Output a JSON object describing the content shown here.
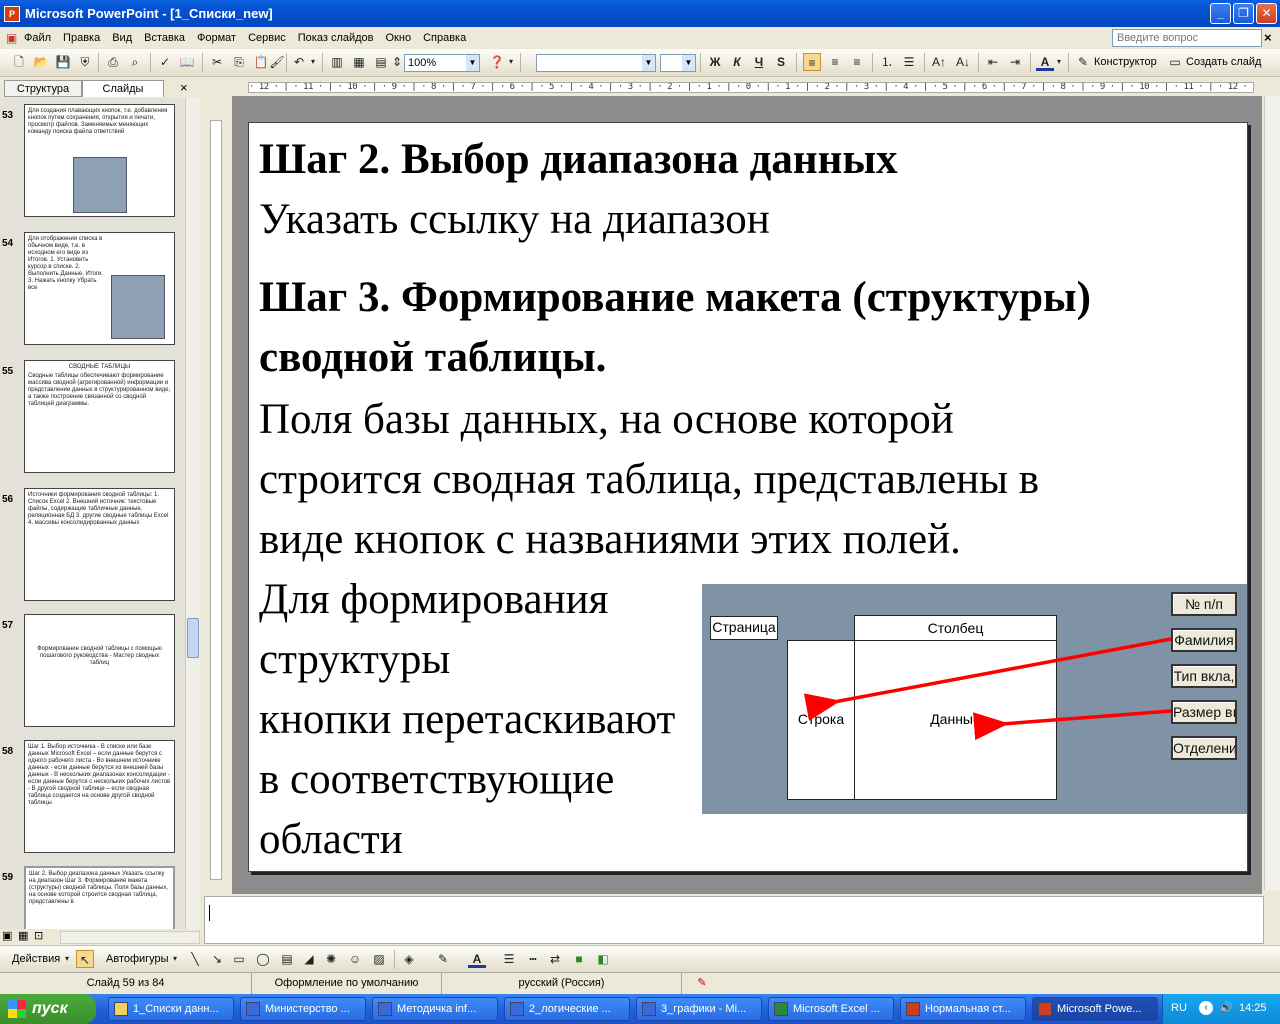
{
  "window": {
    "title": "Microsoft PowerPoint - [1_Списки_new]"
  },
  "menu": {
    "items": [
      "Файл",
      "Правка",
      "Вид",
      "Вставка",
      "Формат",
      "Сервис",
      "Показ слайдов",
      "Окно",
      "Справка"
    ],
    "help_placeholder": "Введите вопрос"
  },
  "toolbar": {
    "zoom": "100%",
    "designer_label": "Конструктор",
    "create_slide_label": "Создать слайд",
    "bold": "Ж",
    "italic": "К",
    "underline": "Ч",
    "shadow": "S"
  },
  "pane": {
    "tab_structure": "Структура",
    "tab_slides": "Слайды"
  },
  "thumbnails": [
    {
      "num": "53",
      "text": "Для создания плавающих кнопок, т.е. добавления кнопок путем сохранения, открытия и печати, просмотр файлов. Заменяемых меняющих команду поиска файла ответствий"
    },
    {
      "num": "54",
      "text": "Для отображения списка в обычном виде, т.е. в исходном его виде из Итогов. 1. Установить курсор в списке. 2. Выполнить Данные, Итоги. 3. Нажать кнопку Убрать все"
    },
    {
      "num": "55",
      "title": "СВОДНЫЕ ТАБЛИЦЫ",
      "text": "Сводные таблицы обеспечивают формирование массива сводной (агрегированной) информации и представление данных в структурированном виде, а также построение связанной со сводной таблицей диаграммы."
    },
    {
      "num": "56",
      "text": "Источники формирования сводной таблицы: 1. Список Excel 2. Внешний источник: текстовые файлы, содержащие табличные данные, реляционная БД 3. другие сводные таблицы Excel 4. массивы консолидированных данных"
    },
    {
      "num": "57",
      "text": "Формирование сводной таблицы с помощью пошагового руководства - Мастер сводных таблиц"
    },
    {
      "num": "58",
      "text": "Шаг 1. Выбор источника - В списке или базе данных Microsoft Excel – если данные берутся с одного рабочего листа - Во внешнем источнике данных - если данные берутся из внешней базы данных - В нескольких диапазонах консолидации - если данные берутся с нескольких рабочих листов - В другой сводной таблице – если сводная таблица создается на основе другой сводной таблицы"
    },
    {
      "num": "59",
      "text": "Шаг 2. Выбор диапазона данных Указать ссылку на диапазон Шаг 3. Формирование макета (структуры) сводной таблицы. Поля базы данных, на основе которой строится сводная таблица, представлены в"
    }
  ],
  "ruler": {
    "h": "· 12 · | · 11 · | · 10 · | · 9 · | · 8 · | · 7 · | · 6 · | · 5 · | · 4 · | · 3 · | · 2 · | · 1 · | · 0 · | · 1 · | · 2 · | · 3 · | · 4 · | · 5 · | · 6 · | · 7 · | · 8 · | · 9 · | · 10 · | · 11 · | · 12 ·"
  },
  "slide": {
    "step2_title": "Шаг 2. Выбор диапазона данных",
    "step2_text": "Указать ссылку на диапазон",
    "step3_title_1": "Шаг 3. Формирование макета (структуры)",
    "step3_title_2": "сводной таблицы.",
    "body_1": "Поля базы данных, на основе которой",
    "body_2": "строится сводная таблица, представлены в",
    "body_3": "виде кнопок с названиями этих полей.",
    "side_1": "Для формирования",
    "side_2": "структуры",
    "side_3": "кнопки перетаскивают",
    "side_4": "в соответствующие",
    "side_5": "области",
    "pivot": {
      "page": "Страница",
      "column": "Столбец",
      "row": "Строка",
      "data": "Данные",
      "fields": [
        "№ п/п",
        "Фамилия",
        "Тип вкла,",
        "Размер вı",
        "Отделени"
      ]
    }
  },
  "drawing": {
    "actions": "Действия",
    "autoshapes": "Автофигуры"
  },
  "status": {
    "slide": "Слайд 59 из 84",
    "design": "Оформление по умолчанию",
    "language": "русский (Россия)"
  },
  "taskbar": {
    "start": "пуск",
    "tasks": [
      "1_Списки данн...",
      "Министерство ...",
      "Методичка inf...",
      "2_логические ...",
      "3_графики - Mi...",
      "Microsoft Excel ...",
      "Нормальная ст...",
      "Microsoft Powe..."
    ],
    "lang": "RU",
    "clock": "14:25"
  },
  "colors": {
    "accent_arrow": "#ff0000",
    "pivot_bg": "#8092a6",
    "title_bar": "#0a5fe0"
  }
}
